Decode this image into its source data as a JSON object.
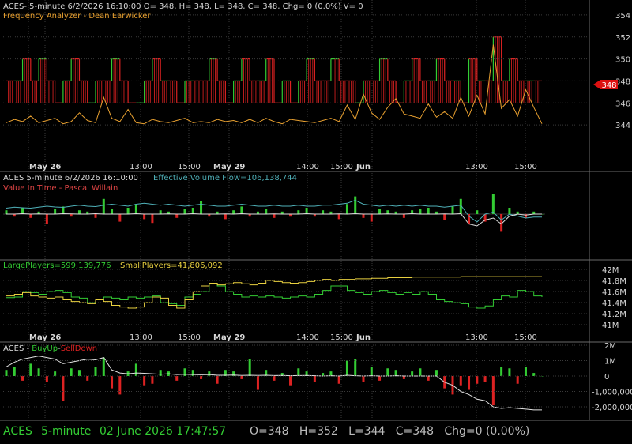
{
  "colors": {
    "background": "#000000",
    "grid": "#3a3a3a",
    "panel_border": "#6a6a6a",
    "text": "#d8d8d8",
    "green": "#33cc33",
    "red": "#dd2222",
    "yellow": "#e8d040",
    "orange": "#e8a030",
    "cyan": "#4fb0b8",
    "white": "#e0e0e0",
    "price_marker": "#dd1111"
  },
  "status_bar": {
    "symbol": "ACES",
    "interval": "5-minute",
    "datetime": "02 June 2026 17:47:57",
    "ohlc": "O=348   H=352   L=344   C=348   Chg=0 (0.00%)"
  },
  "x_axis": {
    "ticks": [
      "May 26",
      "13:00",
      "15:00",
      "May 29",
      "14:00",
      "15:00",
      "Jun",
      "13:00",
      "15:00"
    ],
    "bold_ticks": [
      "May 26",
      "May 29",
      "Jun"
    ]
  },
  "chart_data": [
    {
      "type": "bar",
      "panel": "price",
      "header_lines": [
        "ACES- 5-minute 6/2/2026 16:10:00 O= 348, H= 348, L= 348, C= 348, Chg= 0 (0.0%) V= 0",
        "Frequency Analyzer - Dean Earwicker"
      ],
      "y_ticks": [
        344,
        346,
        348,
        350,
        352,
        354
      ],
      "ylim": [
        343,
        355
      ],
      "last_price_marker": "348",
      "price_series": [
        348,
        348,
        350,
        348,
        350,
        348,
        346,
        348,
        350,
        348,
        346,
        348,
        348,
        350,
        348,
        346,
        346,
        348,
        350,
        348,
        348,
        346,
        348,
        348,
        348,
        350,
        348,
        346,
        348,
        350,
        348,
        348,
        350,
        346,
        348,
        346,
        348,
        350,
        348,
        348,
        350,
        348,
        348,
        346,
        348,
        348,
        350,
        348,
        346,
        348,
        350,
        348,
        348,
        350,
        348,
        348,
        346,
        350,
        348,
        348,
        352,
        348,
        350,
        348,
        348,
        348,
        348
      ],
      "oscillator_series": [
        344.2,
        344.5,
        344.3,
        344.8,
        344.2,
        344.4,
        344.6,
        344.1,
        344.3,
        345.1,
        344.4,
        344.2,
        346.5,
        344.6,
        344.3,
        345.4,
        344.2,
        344.1,
        344.5,
        344.3,
        344.2,
        344.4,
        344.6,
        344.2,
        344.3,
        344.2,
        344.5,
        344.3,
        344.4,
        344.2,
        344.5,
        344.2,
        344.6,
        344.3,
        344.1,
        344.5,
        344.4,
        344.3,
        344.2,
        344.4,
        344.6,
        344.3,
        345.8,
        344.5,
        346.8,
        345.1,
        344.5,
        345.6,
        346.4,
        345.0,
        344.8,
        344.6,
        345.9,
        344.7,
        345.2,
        344.6,
        346.5,
        344.8,
        346.7,
        345.0,
        351.3,
        345.5,
        346.3,
        344.8,
        347.2,
        345.6,
        344.1
      ]
    },
    {
      "type": "bar",
      "panel": "volume_flow",
      "header_lines": [
        "ACES 5-minute  6/2/2026 16:10:00",
        "Effective Volume Flow=106,138,744",
        "Value In Time - Pascal Willain"
      ],
      "histogram": [
        0.3,
        -0.2,
        0.5,
        -0.3,
        0.2,
        -0.8,
        0.4,
        0.6,
        -0.2,
        0.3,
        0.2,
        -0.3,
        1.2,
        0.4,
        -0.6,
        0.5,
        0.8,
        -0.4,
        -0.7,
        0.3,
        0.2,
        -0.3,
        0.4,
        0.5,
        1.0,
        -0.2,
        0.2,
        -0.4,
        0.3,
        0.6,
        -0.2,
        0.2,
        0.4,
        -0.3,
        0.2,
        -0.2,
        0.3,
        0.5,
        -0.2,
        0.3,
        0.2,
        -0.4,
        0.8,
        1.4,
        -0.3,
        -0.6,
        0.4,
        0.3,
        0.2,
        -0.3,
        0.3,
        0.4,
        0.5,
        0.2,
        -0.5,
        0.6,
        1.2,
        -0.8,
        0.3,
        -0.6,
        1.6,
        -1.4,
        0.5,
        0.2,
        -0.3,
        0.2,
        0.0
      ],
      "flow_line": [
        0.9,
        0.95,
        0.92,
        0.9,
        0.95,
        1.0,
        0.96,
        0.94,
        1.0,
        1.05,
        1.0,
        0.98,
        1.05,
        1.1,
        1.05,
        1.0,
        1.1,
        1.15,
        1.1,
        1.05,
        1.1,
        1.05,
        1.0,
        1.05,
        1.1,
        1.05,
        1.0,
        1.0,
        1.05,
        1.1,
        1.05,
        1.0,
        1.0,
        1.05,
        1.0,
        1.0,
        1.05,
        1.0,
        1.0,
        1.05,
        1.05,
        1.1,
        1.15,
        1.3,
        1.1,
        1.05,
        1.0,
        1.05,
        1.0,
        1.05,
        1.0,
        1.05,
        1.0,
        1.0,
        0.95,
        1.0,
        1.05,
        0.5,
        0.2,
        0.6,
        0.7,
        0.3,
        0.6,
        0.5,
        0.4,
        0.45,
        0.45
      ],
      "value_line": [
        0.6,
        0.6,
        0.62,
        0.6,
        0.61,
        0.6,
        0.6,
        0.62,
        0.61,
        0.6,
        0.6,
        0.62,
        0.6,
        0.6,
        0.6,
        0.6,
        0.62,
        0.6,
        0.6,
        0.6,
        0.61,
        0.6,
        0.6,
        0.62,
        0.6,
        0.6,
        0.6,
        0.61,
        0.6,
        0.62,
        0.6,
        0.6,
        0.6,
        0.61,
        0.6,
        0.6,
        0.6,
        0.62,
        0.6,
        0.6,
        0.6,
        0.61,
        0.6,
        0.62,
        0.6,
        0.6,
        0.6,
        0.61,
        0.6,
        0.6,
        0.62,
        0.6,
        0.6,
        0.6,
        0.61,
        0.6,
        0.62,
        0.1,
        0.0,
        0.3,
        0.4,
        0.1,
        0.5,
        0.6,
        0.55,
        0.6,
        0.6
      ]
    },
    {
      "type": "line",
      "panel": "players",
      "series": [
        {
          "name": "LargePlayers=599,139,776",
          "color_key": "green",
          "values": [
            41.49,
            41.5,
            41.6,
            41.58,
            41.55,
            41.6,
            41.62,
            41.58,
            41.5,
            41.48,
            41.4,
            41.45,
            41.5,
            41.48,
            41.45,
            41.5,
            41.48,
            41.5,
            41.52,
            41.4,
            41.38,
            41.35,
            41.5,
            41.55,
            41.6,
            41.75,
            41.7,
            41.6,
            41.55,
            41.5,
            41.52,
            41.5,
            41.52,
            41.5,
            41.48,
            41.5,
            41.52,
            41.5,
            41.55,
            41.62,
            41.7,
            41.7,
            41.62,
            41.58,
            41.55,
            41.6,
            41.62,
            41.58,
            41.55,
            41.58,
            41.55,
            41.6,
            41.55,
            41.45,
            41.42,
            41.4,
            41.38,
            41.32,
            41.3,
            41.34,
            41.45,
            41.52,
            41.5,
            41.62,
            41.6,
            41.52,
            41.5
          ]
        },
        {
          "name": "SmallPlayers=41,806,092",
          "color_key": "yellow",
          "values": [
            41.52,
            41.55,
            41.58,
            41.52,
            41.5,
            41.48,
            41.5,
            41.45,
            41.42,
            41.4,
            41.38,
            41.45,
            41.42,
            41.35,
            41.32,
            41.3,
            41.32,
            41.4,
            41.5,
            41.48,
            41.35,
            41.3,
            41.45,
            41.6,
            41.7,
            41.75,
            41.72,
            41.74,
            41.76,
            41.74,
            41.72,
            41.75,
            41.8,
            41.78,
            41.76,
            41.75,
            41.76,
            41.78,
            41.8,
            41.82,
            41.8,
            41.82,
            41.82,
            41.83,
            41.83,
            41.84,
            41.84,
            41.85,
            41.85,
            41.85,
            41.86,
            41.86,
            41.86,
            41.86,
            41.86,
            41.86,
            41.87,
            41.87,
            41.87,
            41.87,
            41.87,
            41.87,
            41.87,
            41.87,
            41.87,
            41.87,
            41.87
          ]
        }
      ],
      "y_ticks": [
        "41M",
        "41.2M",
        "41.4M",
        "41.6M",
        "41.8M",
        "42M"
      ],
      "y_tick_values": [
        41.0,
        41.2,
        41.4,
        41.6,
        41.8,
        42.0
      ],
      "ylim": [
        40.9,
        42.1
      ]
    },
    {
      "type": "bar",
      "panel": "buyup_selldown",
      "header_symbol": "ACES - ",
      "header_buy": "BuyUp",
      "header_sep": "-",
      "header_sell": "SellDown",
      "y_ticks": [
        "2M",
        "1M",
        "0",
        "-1,000,000",
        "-2,000,000"
      ],
      "y_tick_values": [
        2.0,
        1.0,
        0.0,
        -1.0,
        -2.0
      ],
      "ylim": [
        -2.6,
        2.3
      ],
      "histogram": [
        0.4,
        0.6,
        -0.3,
        0.8,
        0.5,
        -0.4,
        0.3,
        -1.6,
        0.5,
        0.4,
        -0.3,
        0.6,
        1.2,
        -0.8,
        -1.2,
        0.3,
        0.8,
        -0.6,
        -0.5,
        0.4,
        0.3,
        -0.3,
        0.5,
        0.4,
        -0.2,
        0.3,
        -0.5,
        0.4,
        0.3,
        -0.2,
        1.1,
        -0.9,
        0.4,
        -0.3,
        0.2,
        -0.6,
        0.5,
        0.3,
        -0.4,
        0.2,
        0.3,
        -0.5,
        1.0,
        1.1,
        -0.4,
        0.6,
        -0.3,
        0.5,
        0.4,
        -0.2,
        0.3,
        0.5,
        -0.3,
        0.4,
        -0.8,
        -1.2,
        -0.6,
        -0.9,
        -0.5,
        -0.4,
        -1.9,
        0.6,
        0.5,
        -0.5,
        0.6,
        0.2,
        0.0
      ],
      "line": [
        0.6,
        0.9,
        1.1,
        1.2,
        1.3,
        1.2,
        1.1,
        0.8,
        0.9,
        1.0,
        1.1,
        1.05,
        1.2,
        0.4,
        0.2,
        0.15,
        0.2,
        0.18,
        0.15,
        0.12,
        0.15,
        0.1,
        0.12,
        0.1,
        0.08,
        0.1,
        0.05,
        0.05,
        0.06,
        0.04,
        0.05,
        0.04,
        0.05,
        0.03,
        0.04,
        0.02,
        0.03,
        0.04,
        0.02,
        0.0,
        0.02,
        0.0,
        0.05,
        0.02,
        0.0,
        0.02,
        0.0,
        0.0,
        0.02,
        0.0,
        0.0,
        0.0,
        0.0,
        0.0,
        -0.4,
        -0.6,
        -1.0,
        -1.2,
        -1.5,
        -1.6,
        -2.0,
        -2.1,
        -2.05,
        -2.1,
        -2.15,
        -2.2,
        -2.2
      ]
    }
  ]
}
